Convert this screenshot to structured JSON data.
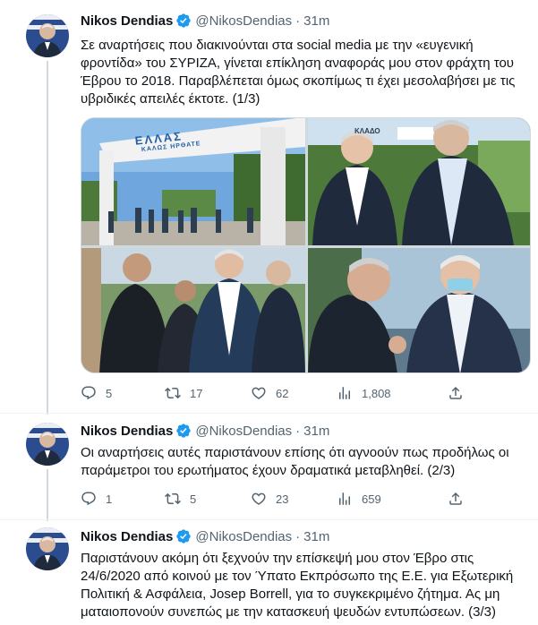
{
  "tweets": [
    {
      "author": {
        "name": "Nikos Dendias",
        "handle": "@NikosDendias"
      },
      "separator": "·",
      "time": "31m",
      "text": {
        "l1": "Σε αναρτήσεις που διακινούνται στα social media με την «ευγενική",
        "l2": "φροντίδα» του ΣΥΡΙΖΑ, γίνεται επίκληση αναφοράς μου στον φράχτη του",
        "l3": "Έβρου το 2018. Παραβλέπεται όμως σκοπίμως τι έχει μεσολαβήσει με τις",
        "l4": "υβριδικές απειλές έκτοτε. (1/3)"
      },
      "media_photos": {
        "p1_sign": "ΕΛΛΑΣ",
        "p1_sign_sub": "ΚΑΛΩΣ ΗΡΘΑΤΕ",
        "p2_sign": "ΚΛΑΔΟ"
      },
      "stats": {
        "replies": "5",
        "retweets": "17",
        "likes": "62",
        "views": "1,808"
      }
    },
    {
      "author": {
        "name": "Nikos Dendias",
        "handle": "@NikosDendias"
      },
      "separator": "·",
      "time": "31m",
      "text": {
        "l1": "Οι αναρτήσεις αυτές παριστάνουν επίσης ότι αγνοούν πως προδήλως οι",
        "l2": "παράμετροι του ερωτήματος έχουν δραματικά μεταβληθεί. (2/3)"
      },
      "stats": {
        "replies": "1",
        "retweets": "5",
        "likes": "23",
        "views": "659"
      }
    },
    {
      "author": {
        "name": "Nikos Dendias",
        "handle": "@NikosDendias"
      },
      "separator": "·",
      "time": "31m",
      "text": {
        "l1": "Παριστάνουν ακόμη ότι ξεχνούν την επίσκεψή μου στον Έβρο στις",
        "l2": "24/6/2020 από κοινού με τον Ύπατο Εκπρόσωπο της Ε.Ε. για Εξωτερική",
        "l3": "Πολιτική & Ασφάλεια, Josep Borrell, για το συγκεκριμένο ζήτημα. Ας μη",
        "l4": "ματαιοπονούν συνεπώς με την κατασκευή ψευδών εντυπώσεων. (3/3)"
      }
    }
  ],
  "colors": {
    "text": "#0f1419",
    "secondary": "#536471",
    "verified": "#1d9bf0",
    "line": "#cfd9de",
    "link": "#0f1419"
  }
}
